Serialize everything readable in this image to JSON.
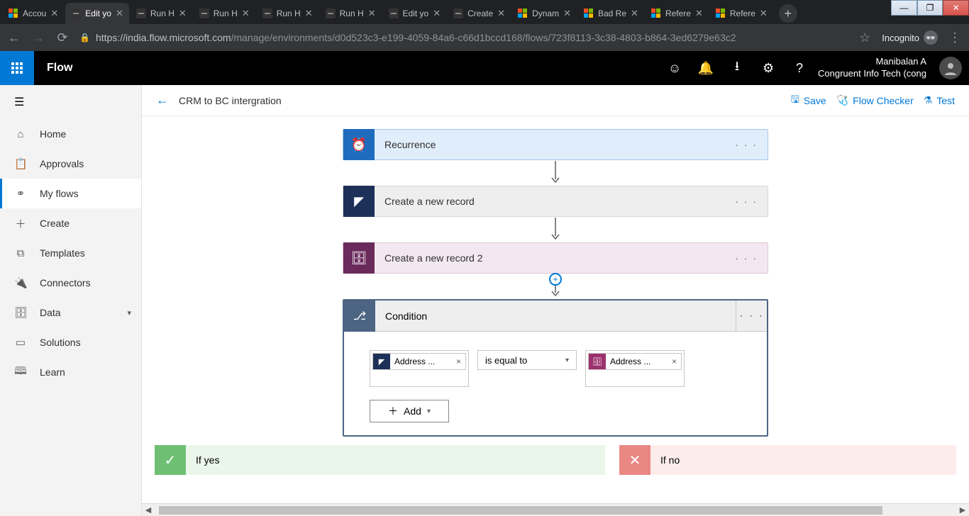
{
  "window_controls": {
    "min": "—",
    "max": "❐",
    "close": "✕"
  },
  "tabs": [
    {
      "type": "ms",
      "label": "Accou"
    },
    {
      "type": "flow",
      "label": "Edit yo",
      "active": true
    },
    {
      "type": "flow",
      "label": "Run H"
    },
    {
      "type": "flow",
      "label": "Run H"
    },
    {
      "type": "flow",
      "label": "Run H"
    },
    {
      "type": "flow",
      "label": "Run H"
    },
    {
      "type": "flow",
      "label": "Edit yo"
    },
    {
      "type": "flow",
      "label": "Create"
    },
    {
      "type": "ms",
      "label": "Dynam"
    },
    {
      "type": "ms",
      "label": "Bad Re"
    },
    {
      "type": "ms",
      "label": "Refere"
    },
    {
      "type": "ms",
      "label": "Refere"
    }
  ],
  "address": {
    "host": "https://india.flow.microsoft.com",
    "path": "/manage/environments/d0d523c3-e199-4059-84a6-c66d1bccd168/flows/723f8113-3c38-4803-b864-3ed6279e63c2",
    "incognito": "Incognito"
  },
  "header": {
    "app": "Flow",
    "user_name": "Manibalan A",
    "user_org": "Congruent Info Tech (cong"
  },
  "sidebar": {
    "items": [
      {
        "icon": "⌂",
        "label": "Home"
      },
      {
        "icon": "📋",
        "label": "Approvals"
      },
      {
        "icon": "⚭",
        "label": "My flows",
        "active": true
      },
      {
        "icon": "＋",
        "label": "Create"
      },
      {
        "icon": "⧉",
        "label": "Templates"
      },
      {
        "icon": "🔌",
        "label": "Connectors"
      },
      {
        "icon": "🗄",
        "label": "Data",
        "chev": true
      },
      {
        "icon": "▭",
        "label": "Solutions"
      },
      {
        "icon": "🕮",
        "label": "Learn"
      }
    ]
  },
  "cmd": {
    "title": "CRM to BC intergration",
    "save": "Save",
    "checker": "Flow Checker",
    "test": "Test"
  },
  "flow": {
    "recurrence": "Recurrence",
    "step2": "Create a new record",
    "step3": "Create a new record 2",
    "condition_title": "Condition",
    "token_left": "Address ...",
    "operator": "is equal to",
    "token_right": "Address ...",
    "add": "Add",
    "yes": "If yes",
    "no": "If no"
  }
}
